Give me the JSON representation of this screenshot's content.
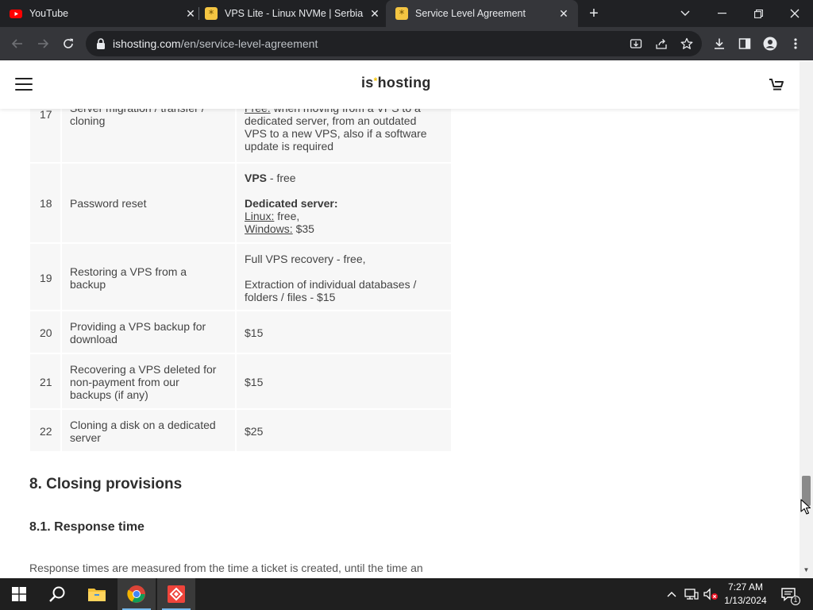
{
  "browser": {
    "tabs": [
      {
        "title": "YouTube",
        "favicon": "youtube-icon",
        "active": false
      },
      {
        "title": "VPS Lite - Linux NVMe | Serbia | ( ",
        "favicon": "ishosting-icon",
        "active": false
      },
      {
        "title": "Service Level Agreement",
        "favicon": "ishosting-icon",
        "active": true
      }
    ],
    "address": {
      "host": "ishosting.com",
      "path": "/en/service-level-agreement"
    }
  },
  "site": {
    "logo_left": "is",
    "logo_star": "*",
    "logo_right": "hosting"
  },
  "table": {
    "rows": [
      {
        "num": "17",
        "service_lines": [
          "Server migration / transfer /",
          "cloning"
        ],
        "cost_parts": [
          {
            "underline": "Free:",
            "text": " when moving from a VPS to a"
          },
          {
            "text": "dedicated server, from an outdated"
          },
          {
            "text": "VPS to a new VPS, also if a software"
          },
          {
            "text": "update is required"
          }
        ]
      },
      {
        "num": "18",
        "service_lines": [
          "Password reset"
        ],
        "cost_parts": [
          {
            "bold": "VPS",
            "text": " - free"
          },
          {
            "text": ""
          },
          {
            "bold": "Dedicated server:"
          },
          {
            "underline": "Linux:",
            "text": " free,"
          },
          {
            "underline": "Windows:",
            "text": " $35"
          }
        ]
      },
      {
        "num": "19",
        "service_lines": [
          "Restoring a VPS from a",
          "backup"
        ],
        "cost_parts": [
          {
            "text": "Full VPS recovery - free,"
          },
          {
            "text": ""
          },
          {
            "text": "Extraction of individual databases /"
          },
          {
            "text": "folders / files - $15"
          }
        ]
      },
      {
        "num": "20",
        "service_lines": [
          "Providing a VPS backup for",
          "download"
        ],
        "cost_parts": [
          {
            "text": "$15"
          }
        ]
      },
      {
        "num": "21",
        "service_lines": [
          "Recovering a VPS deleted for",
          "non-payment from our",
          "backups (if any)"
        ],
        "cost_parts": [
          {
            "text": "$15"
          }
        ]
      },
      {
        "num": "22",
        "service_lines": [
          "Cloning a disk on a dedicated",
          "server"
        ],
        "cost_parts": [
          {
            "text": "$25"
          }
        ]
      }
    ]
  },
  "sections": {
    "closing_title": "8. Closing provisions",
    "response_title": "8.1. Response time",
    "response_text": "Response times are measured from the time a ticket is created, until the time an"
  },
  "taskbar": {
    "apps": [
      "start-icon",
      "search-icon",
      "file-explorer-icon",
      "chrome-icon",
      "anydesk-icon"
    ],
    "time": "7:27 AM",
    "date": "1/13/2024",
    "notification_count": "1"
  }
}
